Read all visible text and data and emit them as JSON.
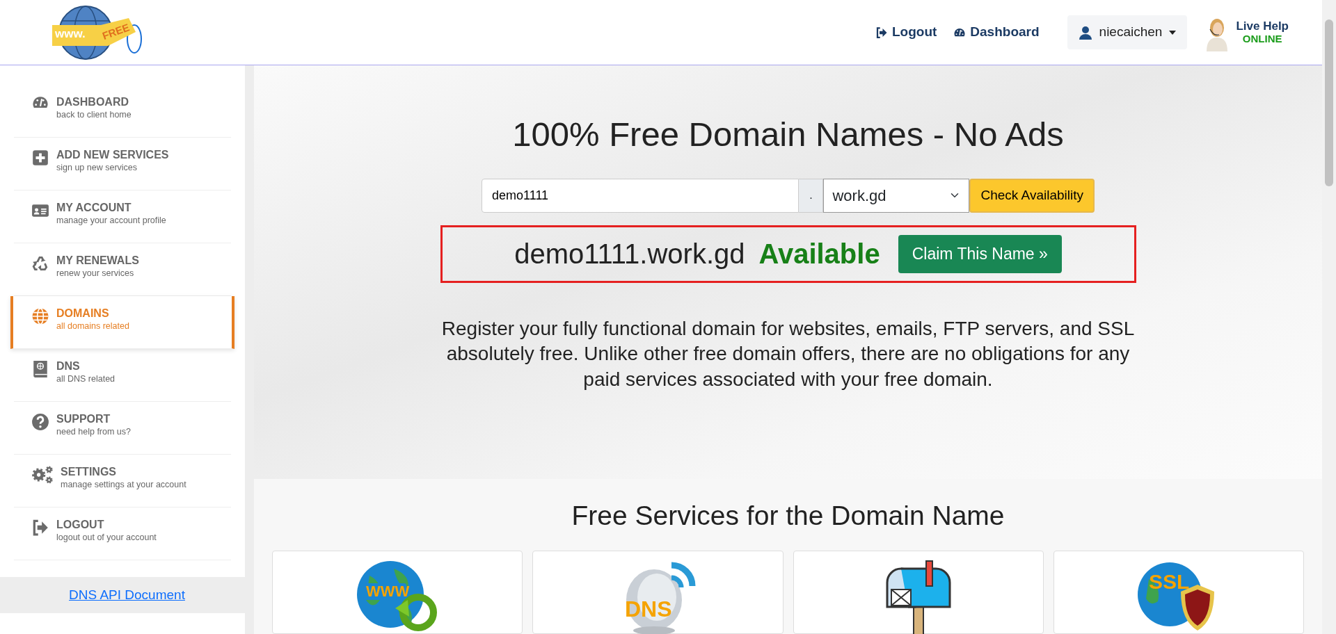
{
  "header": {
    "logo_text": [
      "www.",
      "FREE"
    ],
    "nav": [
      {
        "label": "Logout",
        "kind": "logout"
      },
      {
        "label": "Dashboard",
        "kind": "dashboard"
      }
    ],
    "user": {
      "name": "niecaichen"
    },
    "live_help": {
      "title": "Live Help",
      "status": "ONLINE"
    }
  },
  "sidebar": {
    "items": [
      {
        "title": "DASHBOARD",
        "subtitle": "back to client home",
        "kind": "dashboard",
        "selected": false
      },
      {
        "title": "ADD NEW SERVICES",
        "subtitle": "sign up new services",
        "kind": "plus",
        "selected": false
      },
      {
        "title": "MY ACCOUNT",
        "subtitle": "manage your account profile",
        "kind": "card",
        "selected": false
      },
      {
        "title": "MY RENEWALS",
        "subtitle": "renew your services",
        "kind": "recycle",
        "selected": false
      },
      {
        "title": "DOMAINS",
        "subtitle": "all domains related",
        "kind": "globe",
        "selected": true
      },
      {
        "title": "DNS",
        "subtitle": "all DNS related",
        "kind": "book",
        "selected": false
      },
      {
        "title": "SUPPORT",
        "subtitle": "need help from us?",
        "kind": "question",
        "selected": false
      },
      {
        "title": "SETTINGS",
        "subtitle": "manage settings at your account",
        "kind": "gears",
        "selected": false
      },
      {
        "title": "LOGOUT",
        "subtitle": "logout out of your account",
        "kind": "logout",
        "selected": false
      }
    ],
    "api_link": "DNS API Document"
  },
  "hero": {
    "title": "100% Free Domain Names - No Ads",
    "search": {
      "value": "demo1111",
      "separator": ".",
      "tld": "work.gd",
      "button": "Check Availability"
    },
    "result": {
      "domain": "demo1111.work.gd",
      "status": "Available",
      "button": "Claim This Name »"
    },
    "description": "Register your fully functional domain for websites, emails, FTP servers, and SSL absolutely free. Unlike other free domain offers, there are no obligations for any paid services associated with your free domain."
  },
  "services": {
    "title": "Free Services for the Domain Name",
    "cards": [
      {
        "kind": "www",
        "icon_text": "WWW"
      },
      {
        "kind": "dns",
        "icon_text": "DNS"
      },
      {
        "kind": "mail"
      },
      {
        "kind": "ssl",
        "icon_text": "SSL"
      }
    ]
  }
}
